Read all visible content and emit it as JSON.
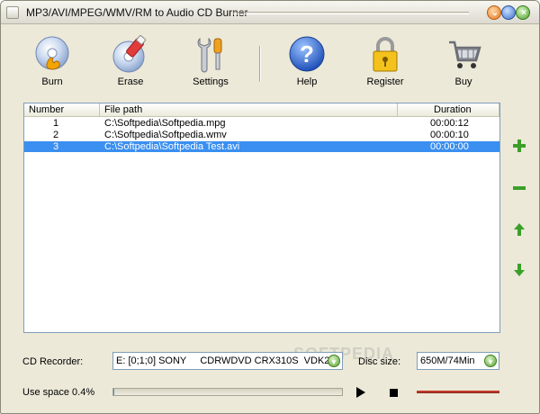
{
  "window": {
    "title": "MP3/AVI/MPEG/WMV/RM to Audio CD Burner"
  },
  "toolbar": {
    "burn": "Burn",
    "erase": "Erase",
    "settings": "Settings",
    "help": "Help",
    "register": "Register",
    "buy": "Buy"
  },
  "list": {
    "columns": [
      "Number",
      "File path",
      "Duration"
    ],
    "rows": [
      {
        "number": "1",
        "path": "C:\\Softpedia\\Softpedia.mpg",
        "duration": "00:00:12",
        "selected": false
      },
      {
        "number": "2",
        "path": "C:\\Softpedia\\Softpedia.wmv",
        "duration": "00:00:10",
        "selected": false
      },
      {
        "number": "3",
        "path": "C:\\Softpedia\\Softpedia Test.avi",
        "duration": "00:00:00",
        "selected": true
      }
    ]
  },
  "side_buttons": [
    "plus-icon",
    "minus-icon",
    "arrow-up-icon",
    "arrow-down-icon"
  ],
  "recorder": {
    "label": "CD Recorder:",
    "value": "E: [0;1;0] SONY     CDRWDVD CRX310S  VDK2"
  },
  "disc": {
    "label": "Disc size:",
    "value": "650M/74Min"
  },
  "usage": {
    "label": "Use space 0.4%",
    "percent": 0.4
  },
  "watermark": "SOFTPEDIA",
  "colors": {
    "selection": "#3a8ff0",
    "accent_green": "#5aa532",
    "volume": "#c0392b"
  }
}
